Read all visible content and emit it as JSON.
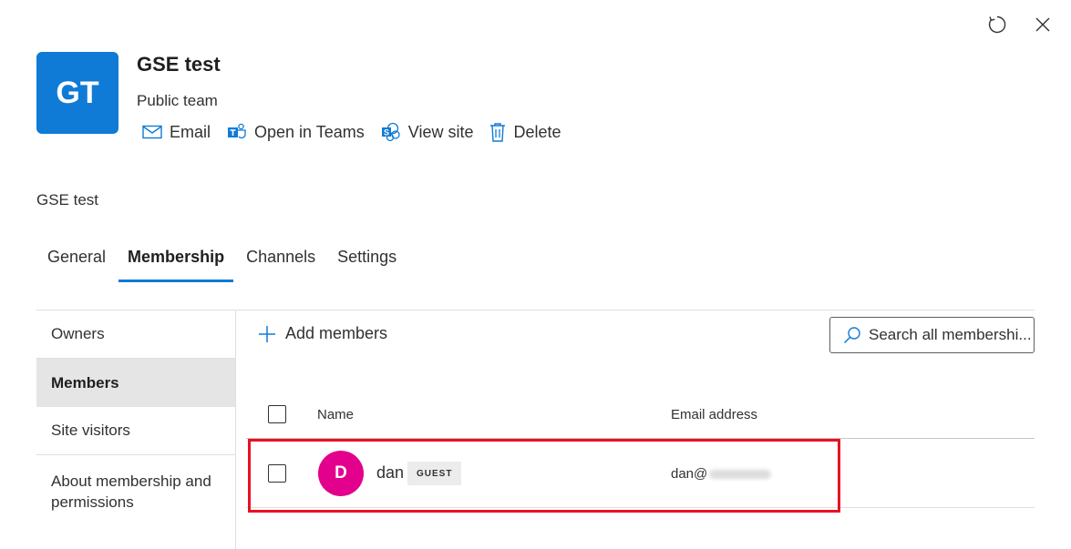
{
  "window": {
    "refresh_icon": "refresh-icon",
    "close_icon": "close-icon"
  },
  "team": {
    "initials": "GT",
    "name": "GSE test",
    "type": "Public team",
    "avatar_color": "#0f7bd6"
  },
  "actions": [
    {
      "label": "Email",
      "icon": "mail-icon"
    },
    {
      "label": "Open in Teams",
      "icon": "teams-icon"
    },
    {
      "label": "View site",
      "icon": "sharepoint-icon"
    },
    {
      "label": "Delete",
      "icon": "trash-icon"
    }
  ],
  "breadcrumb": "GSE test",
  "tabs": [
    {
      "label": "General",
      "active": false
    },
    {
      "label": "Membership",
      "active": true
    },
    {
      "label": "Channels",
      "active": false
    },
    {
      "label": "Settings",
      "active": false
    }
  ],
  "sidebar": {
    "items": [
      {
        "label": "Owners",
        "selected": false
      },
      {
        "label": "Members",
        "selected": true
      },
      {
        "label": "Site visitors",
        "selected": false
      },
      {
        "label": "About membership and permissions",
        "selected": false
      }
    ]
  },
  "toolbar": {
    "add_label": "Add members",
    "search_placeholder": "Search all membershi..."
  },
  "table": {
    "columns": [
      "Name",
      "Email address"
    ],
    "rows": [
      {
        "initial": "D",
        "name": "dan",
        "badge": "GUEST",
        "email": "dan@",
        "avatar_color": "#e3008c"
      }
    ]
  },
  "colors": {
    "accent": "#0f7bd6",
    "highlight": "#e81123"
  }
}
